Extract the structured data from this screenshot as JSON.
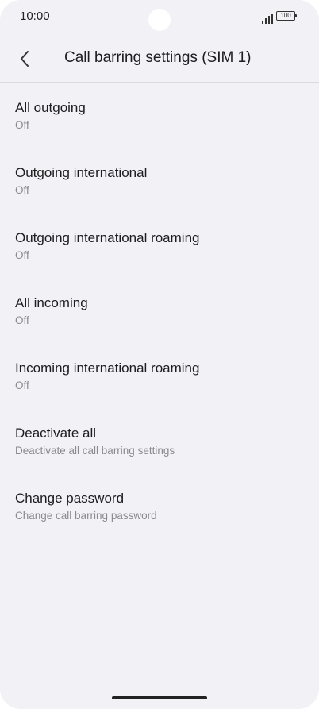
{
  "status_bar": {
    "time": "10:00",
    "battery": "100",
    "icons": [
      "signal-icon",
      "battery-icon"
    ]
  },
  "header": {
    "back_icon": "chevron-left-icon",
    "title": "Call barring settings (SIM 1)"
  },
  "settings": [
    {
      "title": "All outgoing",
      "subtitle": "Off"
    },
    {
      "title": "Outgoing international",
      "subtitle": "Off"
    },
    {
      "title": "Outgoing international roaming",
      "subtitle": "Off"
    },
    {
      "title": "All incoming",
      "subtitle": "Off"
    },
    {
      "title": "Incoming international roaming",
      "subtitle": "Off"
    },
    {
      "title": "Deactivate all",
      "subtitle": "Deactivate all call barring settings"
    },
    {
      "title": "Change password",
      "subtitle": "Change call barring password"
    }
  ]
}
